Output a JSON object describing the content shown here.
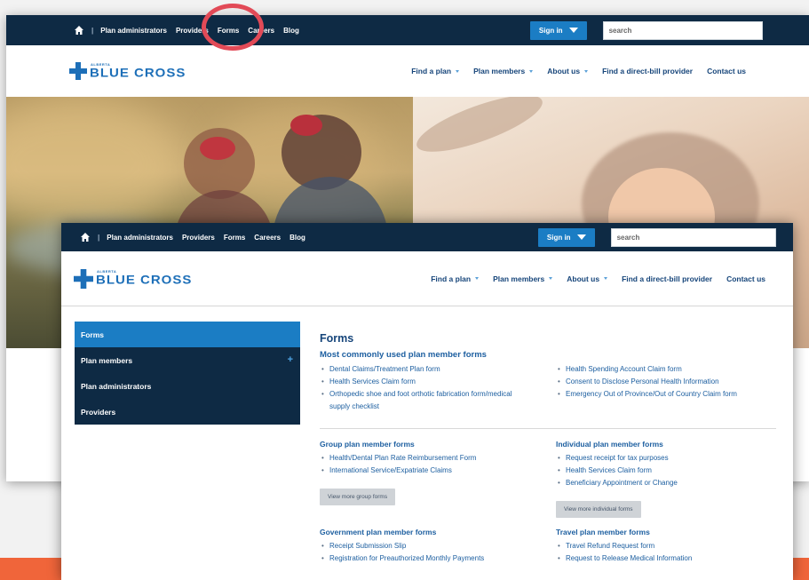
{
  "util_nav": {
    "separator": "|",
    "links": [
      "Plan administrators",
      "Providers",
      "Forms",
      "Careers",
      "Blog"
    ]
  },
  "signin": {
    "label": "Sign in"
  },
  "search": {
    "placeholder": "search"
  },
  "logo": {
    "small": "ALBERTA",
    "big": "BLUE CROSS"
  },
  "main_nav": {
    "items": [
      {
        "label": "Find a plan",
        "has_caret": true
      },
      {
        "label": "Plan members",
        "has_caret": true
      },
      {
        "label": "About us",
        "has_caret": true
      },
      {
        "label": "Find a direct-bill provider",
        "has_caret": false
      },
      {
        "label": "Contact us",
        "has_caret": false
      }
    ]
  },
  "sidebar": {
    "items": [
      {
        "label": "Forms",
        "active": true
      },
      {
        "label": "Plan members",
        "expandable": true
      },
      {
        "label": "Plan administrators"
      },
      {
        "label": "Providers"
      }
    ]
  },
  "content": {
    "title": "Forms",
    "most_used": {
      "heading": "Most commonly used plan member forms",
      "left": [
        "Dental Claims/Treatment Plan form",
        "Health Services Claim form",
        "Orthopedic shoe and foot orthotic fabrication form/medical supply checklist"
      ],
      "right": [
        "Health Spending Account Claim form",
        "Consent to Disclose Personal Health Information",
        "Emergency Out of Province/Out of Country Claim form"
      ]
    },
    "group": {
      "heading": "Group plan member forms",
      "items": [
        "Health/Dental Plan Rate Reimbursement Form",
        "International Service/Expatriate Claims"
      ],
      "button": "View more group forms"
    },
    "individual": {
      "heading": "Individual plan member forms",
      "items": [
        "Request receipt for tax purposes",
        "Health Services Claim form",
        "Beneficiary Appointment or Change"
      ],
      "button": "View more individual forms"
    },
    "government": {
      "heading": "Government plan member forms",
      "items": [
        "Receipt Submission Slip",
        "Registration for Preauthorized Monthly Payments"
      ]
    },
    "travel": {
      "heading": "Travel plan member forms",
      "items": [
        "Travel Refund Request form",
        "Request to Release Medical Information"
      ]
    }
  },
  "colors": {
    "navy": "#0e2a44",
    "brand_blue": "#1b7dc4",
    "link_blue": "#1d5fa0",
    "highlight_ring": "#e24a57",
    "accent_orange": "#f0653a"
  },
  "icons": {
    "home": "home-icon",
    "dropdown": "caret-down-icon",
    "logo_cross": "blue-cross-logo-icon",
    "expand": "plus-icon"
  }
}
